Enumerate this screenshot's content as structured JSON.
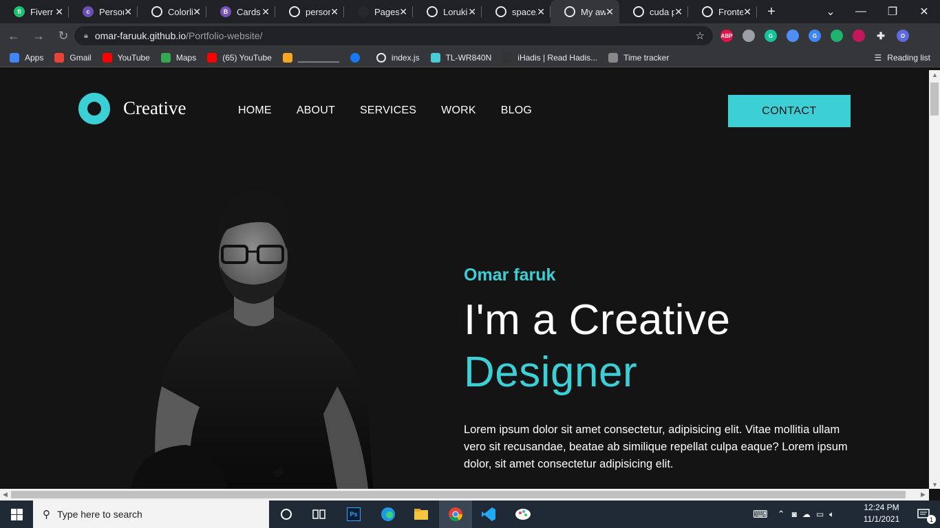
{
  "browser": {
    "tabs": [
      {
        "title": "Fiverr /",
        "icon": "fiverr-icon",
        "color": "#1dbf73",
        "glyph": "fi"
      },
      {
        "title": "Person",
        "icon": "colorlib-icon",
        "color": "#6b4fb8",
        "glyph": "c"
      },
      {
        "title": "Colorli",
        "icon": "globe-icon",
        "color": "#e8eaed",
        "glyph": ""
      },
      {
        "title": "Cards",
        "icon": "bootstrap-icon",
        "color": "#7952b3",
        "glyph": "B"
      },
      {
        "title": "person",
        "icon": "globe-icon",
        "color": "#e8eaed",
        "glyph": ""
      },
      {
        "title": "Pages",
        "icon": "github-icon",
        "color": "#24292e",
        "glyph": ""
      },
      {
        "title": "Loruki",
        "icon": "globe-icon",
        "color": "#e8eaed",
        "glyph": ""
      },
      {
        "title": "spaceX",
        "icon": "globe-icon",
        "color": "#e8eaed",
        "glyph": ""
      },
      {
        "title": "My aw",
        "icon": "globe-icon",
        "color": "#e8eaed",
        "glyph": "",
        "active": true
      },
      {
        "title": "cuda p",
        "icon": "globe-icon",
        "color": "#e8eaed",
        "glyph": ""
      },
      {
        "title": "Fronte",
        "icon": "globe-icon",
        "color": "#e8eaed",
        "glyph": ""
      }
    ],
    "new_tab": "+",
    "url_host": "omar-faruuk.github.io",
    "url_path": "/Portfolio-website/",
    "bookmarks": [
      {
        "label": "Apps",
        "icon": "apps-grid-icon",
        "color": "#4285f4"
      },
      {
        "label": "Gmail",
        "icon": "gmail-icon",
        "color": "#ea4335"
      },
      {
        "label": "YouTube",
        "icon": "youtube-icon",
        "color": "#ff0000"
      },
      {
        "label": "Maps",
        "icon": "maps-icon",
        "color": "#34a853"
      },
      {
        "label": "(65) YouTube",
        "icon": "youtube-icon",
        "color": "#ff0000"
      },
      {
        "label": "_________",
        "icon": "bs-icon",
        "color": "#f5a623"
      },
      {
        "label": "",
        "icon": "facebook-icon",
        "color": "#1877f2"
      },
      {
        "label": "index.js",
        "icon": "globe-icon",
        "color": "#e8eaed"
      },
      {
        "label": "TL-WR840N",
        "icon": "tplink-icon",
        "color": "#4acbd6"
      },
      {
        "label": "iHadis | Read Hadis...",
        "icon": "ihadis-icon",
        "color": "#333"
      },
      {
        "label": "Time tracker",
        "icon": "time-tracker-icon",
        "color": "#888"
      }
    ],
    "reading_list": "Reading list",
    "extensions": [
      {
        "icon": "adblock-icon",
        "color": "#e8134d",
        "glyph": "ABP"
      },
      {
        "icon": "camera-icon",
        "color": "#9aa0a6",
        "glyph": ""
      },
      {
        "icon": "grammarly-icon",
        "color": "#15c39a",
        "glyph": "G"
      },
      {
        "icon": "extension-blue-icon",
        "color": "#4f8ef7",
        "glyph": ""
      },
      {
        "icon": "google-translate-icon",
        "color": "#4285f4",
        "glyph": "G"
      },
      {
        "icon": "sync-icon",
        "color": "#1fb36b",
        "glyph": ""
      },
      {
        "icon": "recorder-icon",
        "color": "#c2185b",
        "glyph": ""
      },
      {
        "icon": "puzzle-icon",
        "color": "#e8eaed",
        "glyph": ""
      },
      {
        "icon": "profile-avatar",
        "color": "#5f6adf",
        "glyph": "O"
      }
    ]
  },
  "site": {
    "logo_text": "Creative",
    "nav": [
      "HOME",
      "ABOUT",
      "SERVICES",
      "WORK",
      "BLOG"
    ],
    "contact_label": "CONTACT",
    "accent": "#3ccfd5",
    "hero": {
      "name": "Omar faruk",
      "line1": "I'm a Creative",
      "line2": "Designer",
      "description": "Lorem ipsum dolor sit amet consectetur, adipisicing elit. Vitae mollitia ullam vero sit recusandae, beatae ab similique repellat culpa eaque? Lorem ipsum dolor, sit amet consectetur adipisicing elit."
    }
  },
  "taskbar": {
    "search_placeholder": "Type here to search",
    "time": "12:24 PM",
    "date": "11/1/2021",
    "notification_count": "1"
  }
}
